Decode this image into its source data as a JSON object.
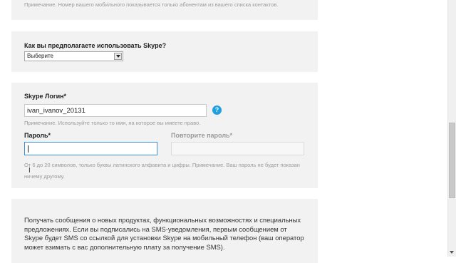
{
  "top": {
    "note": "Примечание. Номер вашего мобильного показывается только абонентам из вашего списка контактов."
  },
  "usage": {
    "label": "Как вы предполагаете использовать Skype?",
    "select_value": "Выберите"
  },
  "login": {
    "label": "Skype Логин*",
    "value": "ivan_ivanov_20131",
    "help_icon": "?",
    "note": "Примечание. Используйте только то имя, на которое вы имеете право.",
    "password_label": "Пароль*",
    "repeat_label": "Повторите пароль*",
    "password_note": "От 6 до 20 символов, только буквы латинского алфавита и цифры. Примечание. Ваш пароль не будет показан ничему другому."
  },
  "promo": {
    "text": "Получать сообщения о новых продуктах, функциональных возможностях и специальных предложениях. Если вы подписались на SMS-уведомления, первым сообщением от Skype будет SMS со ссылкой для установки Skype на мобильный телефон (ваш оператор может взимать с вас дополнительную плату за получение SMS)."
  },
  "icons": {
    "help": "help-icon",
    "cursor": "text-cursor-icon",
    "dropdown": "chevron-down-icon"
  },
  "colors": {
    "panel": "#f2f2f2",
    "accent": "#1d9fe0",
    "focus_border": "#3b8ed8"
  }
}
